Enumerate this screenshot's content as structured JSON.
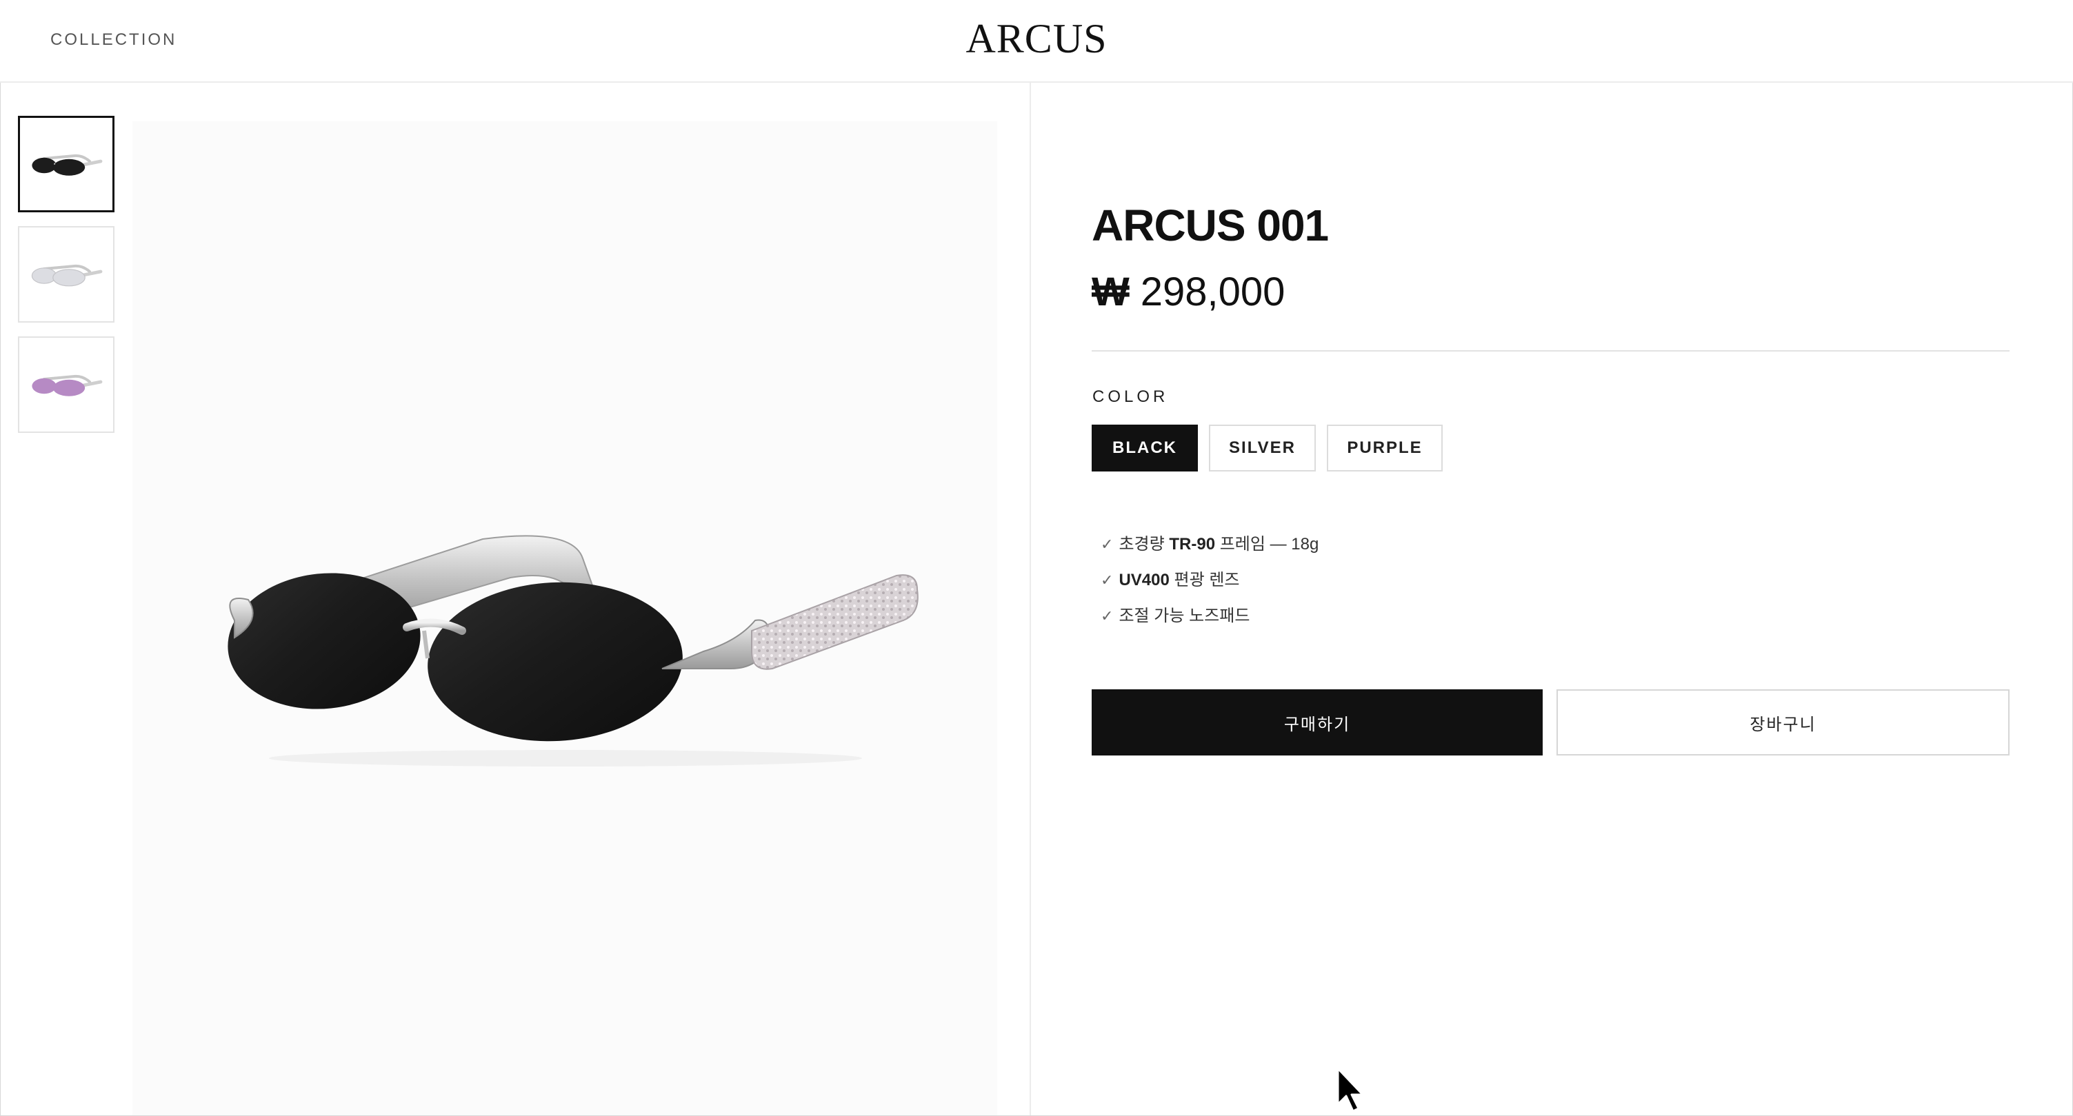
{
  "header": {
    "nav_collection": "COLLECTION",
    "logo": "ARCUS"
  },
  "gallery": {
    "thumbnails": [
      {
        "name": "thumb-black",
        "lens_color": "#1c1c1c",
        "active": true
      },
      {
        "name": "thumb-silver",
        "lens_color": "#dcdde2",
        "active": false
      },
      {
        "name": "thumb-purple",
        "lens_color": "#b68ac4",
        "active": false
      }
    ],
    "main_lens_color": "#1b1b1b"
  },
  "product": {
    "title": "ARCUS 001",
    "currency_symbol": "₩",
    "price": "298,000",
    "color_label": "COLOR",
    "colors": [
      "BLACK",
      "SILVER",
      "PURPLE"
    ],
    "selected_color": "BLACK",
    "features": [
      {
        "check": "✓",
        "pre": "초경량 ",
        "bold": "TR-90",
        "post": " 프레임 — 18g"
      },
      {
        "check": "✓",
        "pre": "",
        "bold": "UV400",
        "post": " 편광 렌즈"
      },
      {
        "check": "✓",
        "pre": "조절 가능 노즈패드",
        "bold": "",
        "post": ""
      }
    ],
    "buy_label": "구매하기",
    "cart_label": "장바구니"
  },
  "colors": {
    "primary": "#111111",
    "border": "#dcdcdc",
    "divider": "#ececec"
  }
}
